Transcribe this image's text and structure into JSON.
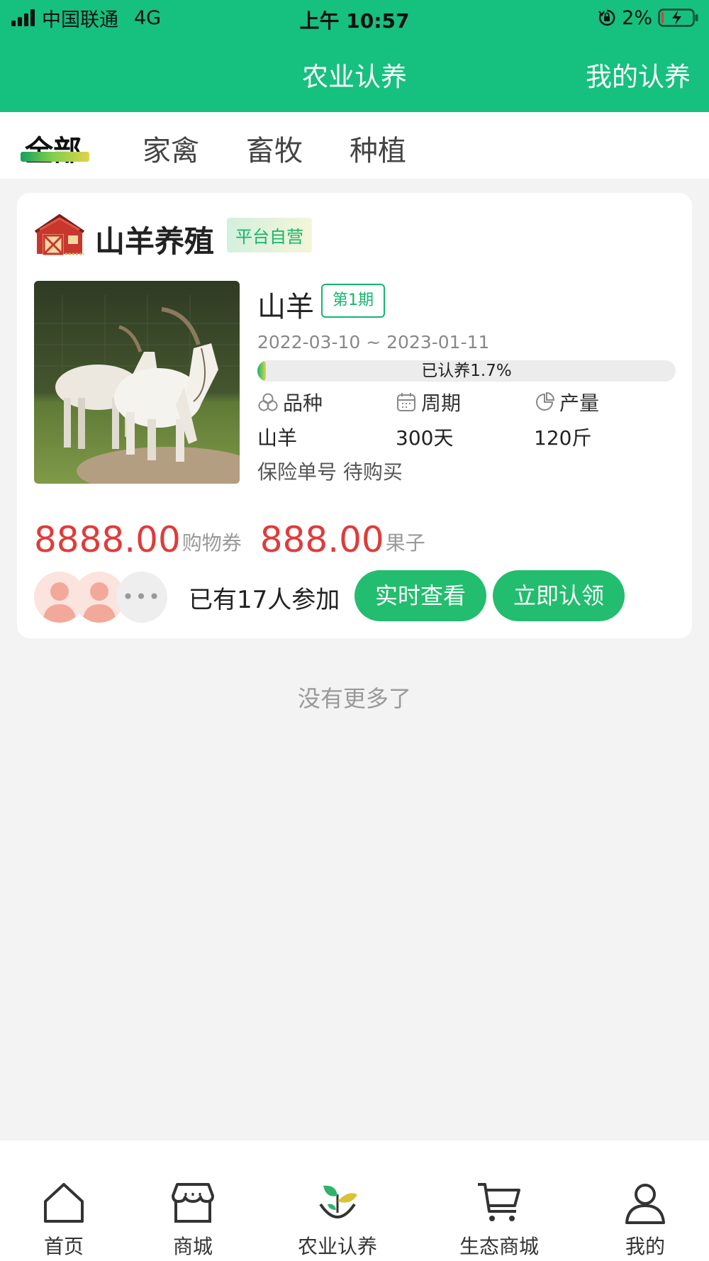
{
  "status_bar": {
    "carrier": "中国联通",
    "network": "4G",
    "time": "上午 10:57",
    "battery": "2%"
  },
  "header": {
    "title": "农业认养",
    "right_link": "我的认养",
    "background_color": "#16c07f"
  },
  "tabs": [
    {
      "label": "全部",
      "active": true
    },
    {
      "label": "家禽",
      "active": false
    },
    {
      "label": "畜牧",
      "active": false
    },
    {
      "label": "种植",
      "active": false
    }
  ],
  "card": {
    "farm_name": "山羊养殖",
    "farm_icon": "barn-icon",
    "badge": "平台自营",
    "product_name": "山羊",
    "period": "第1期",
    "date_range": "2022-03-10 ~ 2023-01-11",
    "progress_label": "已认养1.7%",
    "progress_fraction": 0.017,
    "meta": [
      {
        "label": "品种",
        "icon": "variety-icon",
        "value": "山羊"
      },
      {
        "label": "周期",
        "icon": "calendar-icon",
        "value": "300天"
      },
      {
        "label": "产量",
        "icon": "pie-chart-icon",
        "value": "120斤"
      }
    ],
    "insurance": "保险单号 待购买",
    "price_1": "8888.00",
    "price_1_unit": "购物券",
    "price_2": "888.00",
    "price_2_unit": "果子",
    "participants": "已有17人参加",
    "btn_watch": "实时查看",
    "btn_adopt": "立即认领",
    "price_color": "#e03b3b",
    "accent_color": "#22bd6e"
  },
  "footer_text": "没有更多了",
  "bottom_nav": [
    {
      "label": "首页",
      "icon": "home-icon"
    },
    {
      "label": "商城",
      "icon": "store-icon"
    },
    {
      "label": "农业认养",
      "icon": "sprout-icon"
    },
    {
      "label": "生态商城",
      "icon": "cart-icon"
    },
    {
      "label": "我的",
      "icon": "user-icon"
    }
  ]
}
